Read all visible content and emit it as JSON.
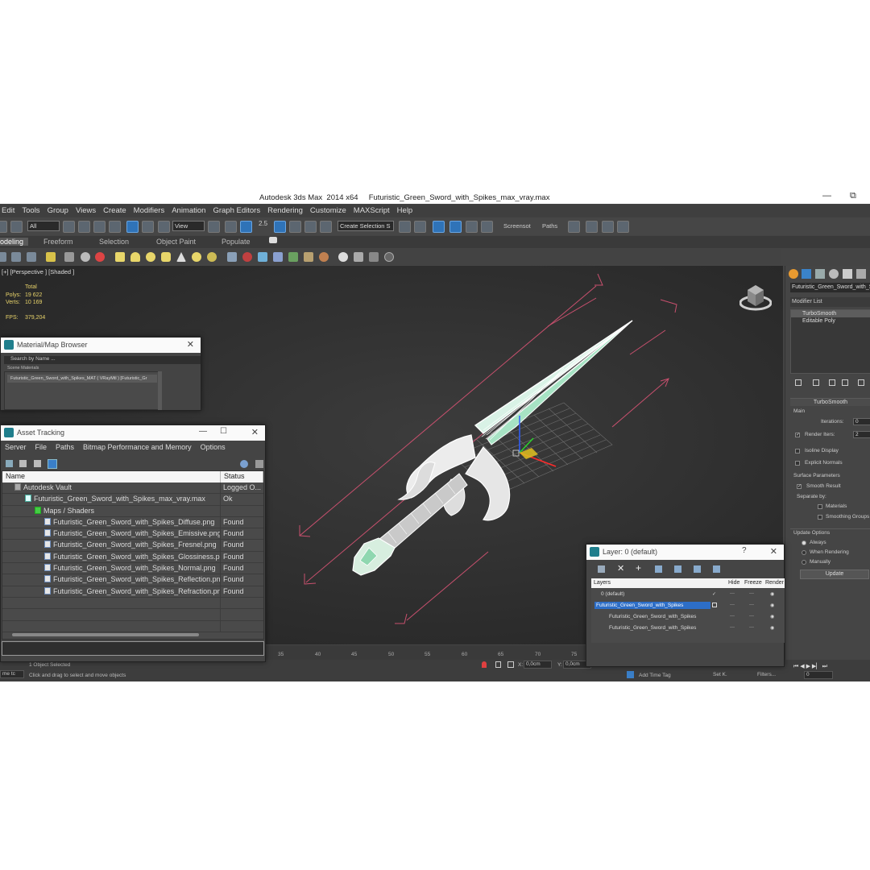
{
  "window": {
    "title": "Autodesk 3ds Max  2014 x64     Futuristic_Green_Sword_with_Spikes_max_vray.max",
    "minimize": "—",
    "maximize": "⧉"
  },
  "menu": [
    "Edit",
    "Tools",
    "Group",
    "Views",
    "Create",
    "Modifiers",
    "Animation",
    "Graph Editors",
    "Rendering",
    "Customize",
    "MAXScript",
    "Help"
  ],
  "toolbar": {
    "filter_value": "All",
    "refcoord_value": "View",
    "snap_label": "2.5",
    "selection_set": "Create Selection S",
    "screenshot_label": "Screensot",
    "paths_label": "Paths"
  },
  "ribbon_tabs": [
    "odeling",
    "Freeform",
    "Selection",
    "Object Paint",
    "Populate"
  ],
  "viewport": {
    "label": "[+] [Perspective ] [Shaded ]",
    "stats": {
      "total_label": "Total",
      "polys_label": "Polys:",
      "polys_value": "19 622",
      "verts_label": "Verts:",
      "verts_value": "10 169",
      "fps_label": "FPS:",
      "fps_value": "379,204"
    }
  },
  "right_panel": {
    "object_name": "Futuristic_Green_Sword_with_Spi",
    "modifier_list_label": "Modifier List",
    "stack": [
      "TurboSmooth",
      "Editable Poly"
    ],
    "rollout_title": "TurboSmooth",
    "main_label": "Main",
    "iterations_label": "Iterations:",
    "iterations_value": "0",
    "render_iters_label": "Render Iters:",
    "render_iters_value": "2",
    "isoline_label": "Isoline Display",
    "explicit_normals_label": "Explicit Normals",
    "surface_params_label": "Surface Parameters",
    "smooth_result_label": "Smooth Result",
    "separate_by_label": "Separate by:",
    "materials_label": "Materials",
    "smoothing_groups_label": "Smoothing Groups",
    "update_options_label": "Update Options",
    "always_label": "Always",
    "when_rendering_label": "When Rendering",
    "manually_label": "Manually",
    "update_button": "Update"
  },
  "material_browser": {
    "title": "Material/Map Browser",
    "search_placeholder": "Search by Name ...",
    "group_label": "Scene Materials",
    "item_text": "Futuristic_Green_Sword_with_Spikes_MAT ( VRayMtl ) [Futuristic_Gr",
    "item_highlight": "Futuristic_Gr"
  },
  "asset_tracking": {
    "title": "Asset Tracking",
    "menu": [
      "Server",
      "File",
      "Paths",
      "Bitmap Performance and Memory",
      "Options"
    ],
    "columns": [
      "Name",
      "Status"
    ],
    "rows": [
      {
        "name": "Autodesk Vault",
        "status": "Logged O..."
      },
      {
        "name": "Futuristic_Green_Sword_with_Spikes_max_vray.max",
        "status": "Ok"
      },
      {
        "name": "Maps / Shaders",
        "status": ""
      },
      {
        "name": "Futuristic_Green_Sword_with_Spikes_Diffuse.png",
        "status": "Found"
      },
      {
        "name": "Futuristic_Green_Sword_with_Spikes_Emissive.png",
        "status": "Found"
      },
      {
        "name": "Futuristic_Green_Sword_with_Spikes_Fresnel.png",
        "status": "Found"
      },
      {
        "name": "Futuristic_Green_Sword_with_Spikes_Glossiness.png",
        "status": "Found"
      },
      {
        "name": "Futuristic_Green_Sword_with_Spikes_Normal.png",
        "status": "Found"
      },
      {
        "name": "Futuristic_Green_Sword_with_Spikes_Reflection.png",
        "status": "Found"
      },
      {
        "name": "Futuristic_Green_Sword_with_Spikes_Refraction.png",
        "status": "Found"
      }
    ]
  },
  "layer_dialog": {
    "title": "Layer: 0 (default)",
    "help": "?",
    "columns": {
      "layers": "Layers",
      "hide": "Hide",
      "freeze": "Freeze",
      "render": "Render"
    },
    "rows": [
      {
        "name": "0 (default)"
      },
      {
        "name": "Futuristic_Green_Sword_with_Spikes"
      },
      {
        "name": "Futuristic_Green_Sword_with_Spikes"
      },
      {
        "name": "Futuristic_Green_Sword_with_Spikes"
      }
    ]
  },
  "timeline": {
    "ticks": [
      "35",
      "40",
      "45",
      "50",
      "55",
      "60",
      "65",
      "70",
      "75"
    ]
  },
  "status": {
    "left_field": "me  tc",
    "selected_text": "1 Object Selected",
    "prompt": "Click and drag to select and move objects",
    "x_label": "X:",
    "x_value": "0,0cm",
    "y_label": "Y:",
    "y_value": "0,0cm",
    "add_time_tag": "Add Time Tag",
    "set_key": "Set K.",
    "filters": "Filters...",
    "frame_value": "0"
  },
  "colors": {
    "wire": "#ffffff",
    "mesh_green": "#8ee0b8",
    "bbox": "#c8506e",
    "grid": "#777777",
    "selection_blue": "#2d6ec7"
  }
}
